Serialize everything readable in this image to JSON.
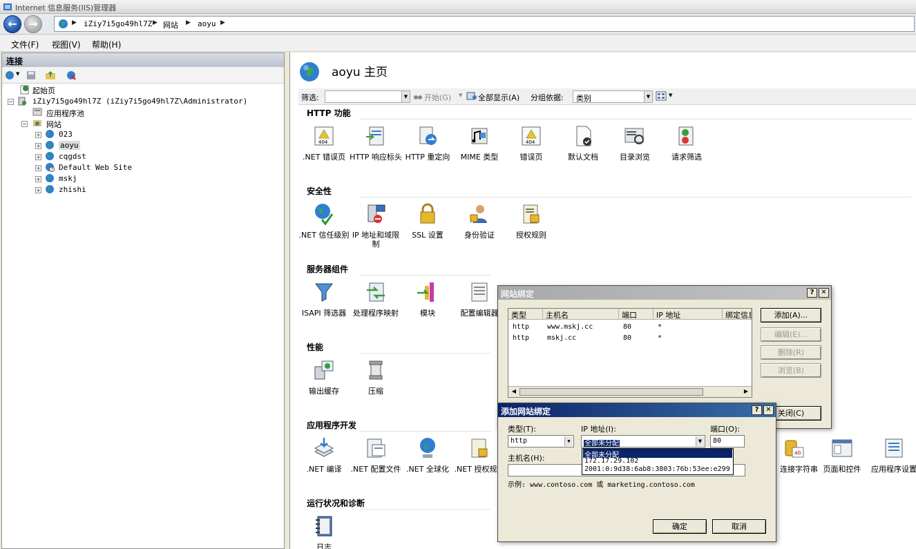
{
  "app": {
    "title": "Internet 信息服务(IIS)管理器"
  },
  "address": {
    "crumbs": [
      "iZiy7i5go49hl7Z",
      "网站",
      "aoyu"
    ]
  },
  "menu": [
    "文件(F)",
    "视图(V)",
    "帮助(H)"
  ],
  "connections": {
    "header": "连接",
    "tree": {
      "start": "起始页",
      "server": "iZiy7i5go49hl7Z (iZiy7i5go49hl7Z\\Administrator)",
      "apppools": "应用程序池",
      "sites_label": "网站",
      "sites": [
        "023",
        "aoyu",
        "cqgdst",
        "Default Web Site",
        "mskj",
        "zhishi"
      ]
    }
  },
  "main": {
    "title": "aoyu 主页",
    "filter": {
      "label": "筛选:",
      "start": "开始(G)",
      "showall": "全部显示(A)",
      "groupby": "分组依据:",
      "groupval": "类别"
    },
    "sections": [
      {
        "name": "HTTP 功能",
        "items": [
          ".NET 错误页",
          "HTTP 响应标头",
          "HTTP 重定向",
          "MIME 类型",
          "错误页",
          "默认文档",
          "目录浏览",
          "请求筛选"
        ]
      },
      {
        "name": "安全性",
        "items": [
          ".NET 信任级别",
          "IP 地址和域限制",
          "SSL 设置",
          "身份验证",
          "授权规则"
        ]
      },
      {
        "name": "服务器组件",
        "items": [
          "ISAPI 筛选器",
          "处理程序映射",
          "模块",
          "配置编辑器"
        ]
      },
      {
        "name": "性能",
        "items": [
          "输出缓存",
          "压缩"
        ]
      },
      {
        "name": "应用程序开发",
        "items": [
          ".NET 编译",
          ".NET 配置文件",
          ".NET 全球化",
          ".NET 授权规则"
        ]
      },
      {
        "name": "运行状况和诊断",
        "items": [
          "日志"
        ]
      }
    ],
    "extra": [
      "连接字符串",
      "页面和控件",
      "应用程序设置"
    ]
  },
  "bindings_dialog": {
    "title": "网站绑定",
    "columns": [
      "类型",
      "主机名",
      "端口",
      "IP 地址",
      "绑定信息"
    ],
    "rows": [
      {
        "type": "http",
        "host": "www.mskj.cc",
        "port": "80",
        "ip": "*"
      },
      {
        "type": "http",
        "host": "mskj.cc",
        "port": "80",
        "ip": "*"
      }
    ],
    "buttons": {
      "add": "添加(A)...",
      "edit": "编辑(E)...",
      "remove": "删除(R)",
      "browse": "浏览(B)",
      "close": "关闭(C)"
    }
  },
  "add_dialog": {
    "title": "添加网站绑定",
    "type_label": "类型(T):",
    "type_value": "http",
    "ip_label": "IP 地址(I):",
    "ip_value": "全部未分配",
    "port_label": "端口(O):",
    "port_value": "80",
    "host_label": "主机名(H):",
    "host_value": "",
    "example": "示例: www.contoso.com 或 marketing.contoso.com",
    "ip_options": [
      "全部未分配",
      "172.17.29.102",
      "2001:0:9d38:6ab8:3803:76b:53ee:e299"
    ],
    "ok": "确定",
    "cancel": "取消"
  }
}
